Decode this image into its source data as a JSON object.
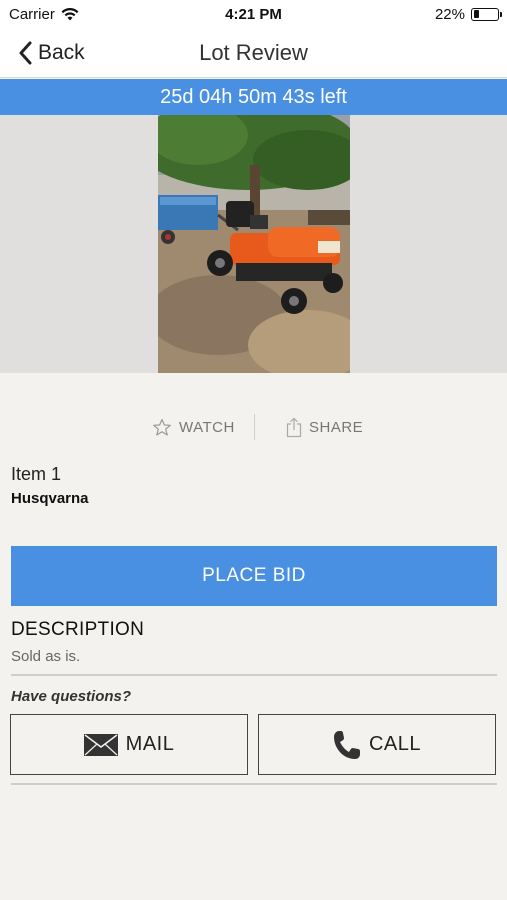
{
  "status_bar": {
    "carrier": "Carrier",
    "time": "4:21 PM",
    "battery_text": "22%",
    "battery_level": 0.22
  },
  "nav": {
    "back_label": "Back",
    "title": "Lot Review"
  },
  "auction": {
    "time_left": "25d 04h 50m 43s left"
  },
  "actions": {
    "watch_label": "WATCH",
    "share_label": "SHARE"
  },
  "item": {
    "title": "Item 1",
    "subtitle": "Husqvarna"
  },
  "bid": {
    "label": "PLACE BID"
  },
  "description": {
    "heading": "DESCRIPTION",
    "text": "Sold as is."
  },
  "contact": {
    "prompt": "Have questions?",
    "mail_label": "MAIL",
    "call_label": "CALL"
  },
  "colors": {
    "accent": "#4a90e2",
    "background": "#f3f2ef"
  },
  "icons": [
    "wifi-icon",
    "battery-icon",
    "chevron-left-icon",
    "star-icon",
    "share-icon",
    "envelope-icon",
    "phone-icon"
  ]
}
